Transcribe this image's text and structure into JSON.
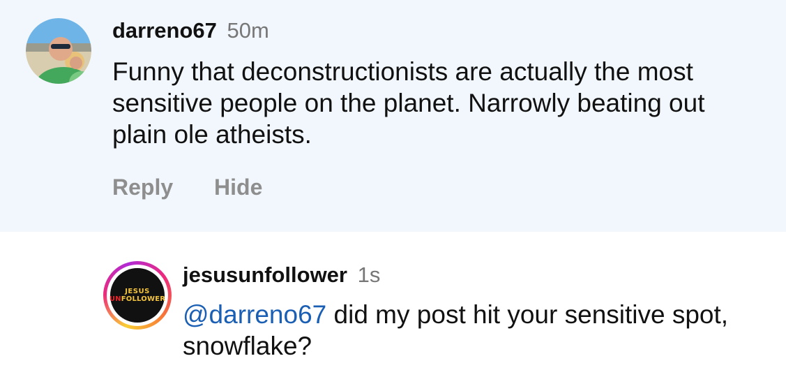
{
  "comment": {
    "username": "darreno67",
    "time": "50m",
    "text": "Funny that deconstructionists are actually the most sensitive people on the planet.  Narrowly beating out plain ole atheists.",
    "actions": {
      "reply": "Reply",
      "hide": "Hide"
    }
  },
  "reply": {
    "username": "jesusunfollower",
    "time": "1s",
    "mention": "@darreno67",
    "text": " did my post hit your sensitive spot, snowflake?",
    "avatar_logo": {
      "line1": "JESUS",
      "line2_a": "UN",
      "line2_b": "FOLLOWER"
    }
  },
  "colors": {
    "highlight_bg": "#f1f7fc",
    "mention": "#1a5fb4",
    "muted": "#8e8e8e"
  }
}
